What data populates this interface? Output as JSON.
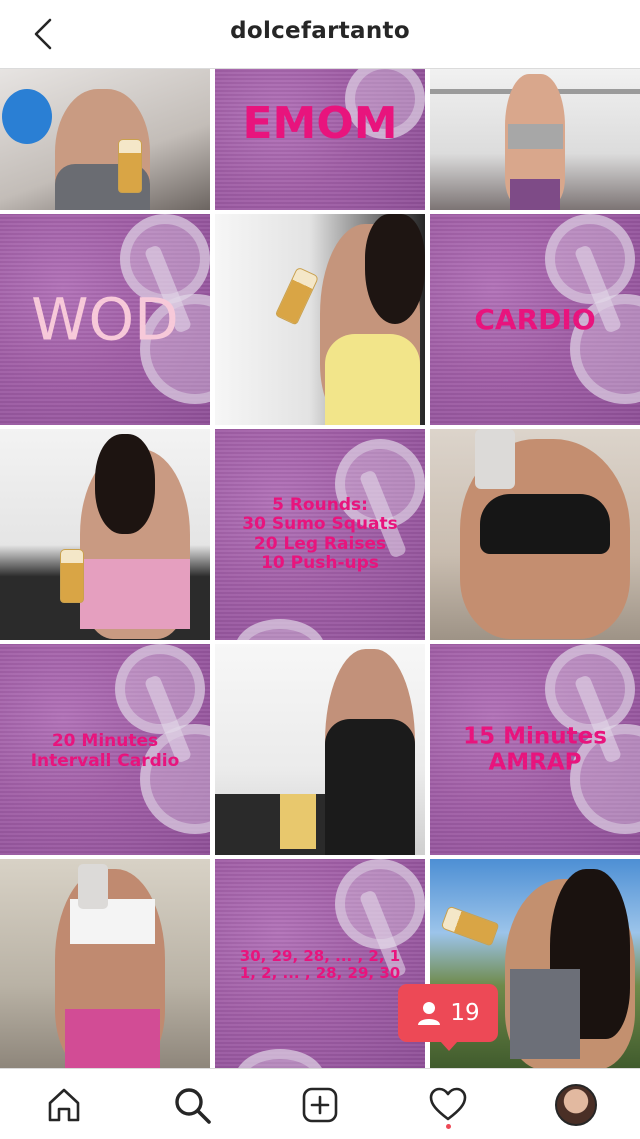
{
  "header": {
    "title": "dolcefartanto",
    "back_icon": "chevron-left-icon"
  },
  "grid": {
    "tiles": [
      {
        "kind": "photo",
        "desc_icon": "photo"
      },
      {
        "kind": "graphic",
        "text": "EMOM"
      },
      {
        "kind": "photo",
        "desc_icon": "photo"
      },
      {
        "kind": "graphic",
        "text": "WOD"
      },
      {
        "kind": "photo",
        "desc_icon": "photo"
      },
      {
        "kind": "graphic",
        "text": "CARDIO"
      },
      {
        "kind": "photo",
        "desc_icon": "photo"
      },
      {
        "kind": "graphic",
        "text": "5 Rounds:\n30 Sumo Squats\n20 Leg Raises\n10 Push-ups"
      },
      {
        "kind": "photo",
        "desc_icon": "photo"
      },
      {
        "kind": "graphic",
        "text": "20 Minutes\nIntervall Cardio"
      },
      {
        "kind": "photo",
        "desc_icon": "photo"
      },
      {
        "kind": "graphic",
        "text": "15 Minutes\nAMRAP"
      },
      {
        "kind": "photo",
        "desc_icon": "photo"
      },
      {
        "kind": "graphic",
        "text": "30, 29, 28, ... , 2, 1\n1, 2, ... , 28, 29, 30"
      },
      {
        "kind": "photo",
        "desc_icon": "photo"
      }
    ]
  },
  "notification": {
    "icon": "person-icon",
    "count": "19"
  },
  "tabbar": {
    "items": [
      {
        "name": "home-icon"
      },
      {
        "name": "search-icon"
      },
      {
        "name": "add-post-icon"
      },
      {
        "name": "heart-icon"
      },
      {
        "name": "profile-avatar"
      }
    ]
  },
  "colors": {
    "accent": "#e8147d",
    "tile_purple": "#a05ea6",
    "notification_red": "#ed4956",
    "divider": "#dbdbdb"
  }
}
